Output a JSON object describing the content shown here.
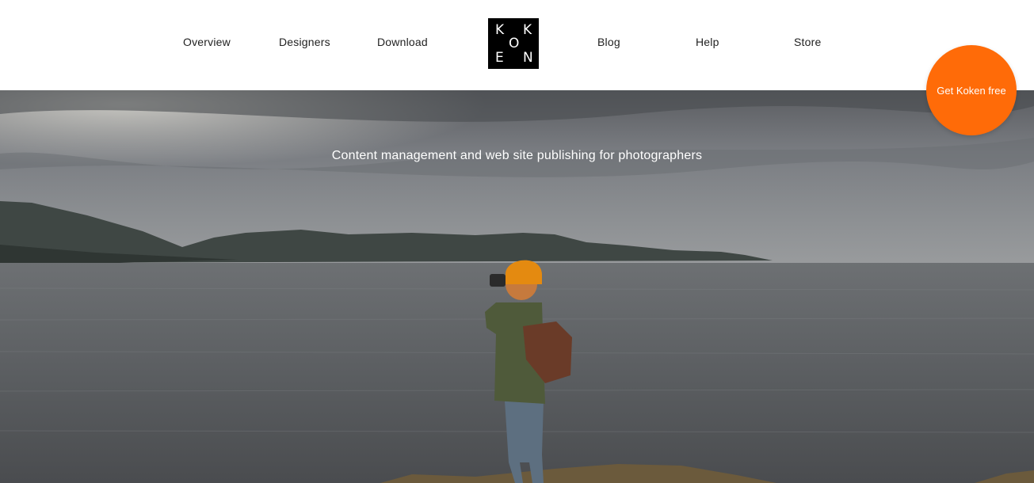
{
  "nav": {
    "left": [
      "Overview",
      "Designers",
      "Download"
    ],
    "right": [
      "Blog",
      "Help",
      "Store"
    ]
  },
  "logo": {
    "letters": [
      "K",
      "K",
      "O",
      "E",
      "N"
    ],
    "bg": "#000000",
    "fg": "#ffffff"
  },
  "hero": {
    "tagline": "Content management and web site publishing for photographers"
  },
  "cta": {
    "label": "Get Koken free",
    "color": "#ff6b08"
  }
}
